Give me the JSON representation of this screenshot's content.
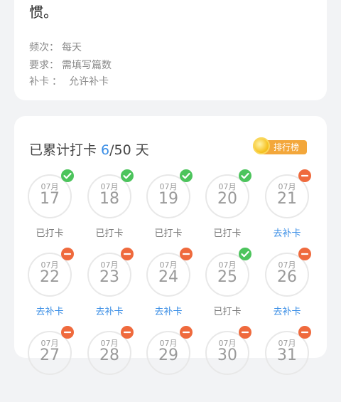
{
  "task": {
    "description": "诗来撷本上，这样能更好地帮助孩子培养好习惯。",
    "frequency_label": "频次：",
    "frequency_value": "每天",
    "requirement_label": "要求：",
    "requirement_value": "需填写篇数",
    "makeup_label": "补卡",
    "makeup_sep": "：",
    "makeup_value": "允许补卡"
  },
  "summary": {
    "prefix": "已累计打卡 ",
    "done": "6",
    "suffix": "/50 天",
    "rank_label": "排行榜"
  },
  "colors": {
    "done": "#4cc45c",
    "missed": "#ef6a3d",
    "link": "#3a8ee6",
    "rank": "#f3a73b"
  },
  "days": [
    {
      "month": "07月",
      "date": "17",
      "state": "done",
      "status": "已打卡"
    },
    {
      "month": "07月",
      "date": "18",
      "state": "done",
      "status": "已打卡"
    },
    {
      "month": "07月",
      "date": "19",
      "state": "done",
      "status": "已打卡"
    },
    {
      "month": "07月",
      "date": "20",
      "state": "done",
      "status": "已打卡"
    },
    {
      "month": "07月",
      "date": "21",
      "state": "miss",
      "status": "去补卡"
    },
    {
      "month": "07月",
      "date": "22",
      "state": "miss",
      "status": "去补卡"
    },
    {
      "month": "07月",
      "date": "23",
      "state": "miss",
      "status": "去补卡"
    },
    {
      "month": "07月",
      "date": "24",
      "state": "miss",
      "status": "去补卡"
    },
    {
      "month": "07月",
      "date": "25",
      "state": "done",
      "status": "已打卡"
    },
    {
      "month": "07月",
      "date": "26",
      "state": "miss",
      "status": "去补卡"
    },
    {
      "month": "07月",
      "date": "27",
      "state": "miss",
      "status": ""
    },
    {
      "month": "07月",
      "date": "28",
      "state": "miss",
      "status": ""
    },
    {
      "month": "07月",
      "date": "29",
      "state": "miss",
      "status": ""
    },
    {
      "month": "07月",
      "date": "30",
      "state": "miss",
      "status": ""
    },
    {
      "month": "07月",
      "date": "31",
      "state": "miss",
      "status": ""
    }
  ]
}
